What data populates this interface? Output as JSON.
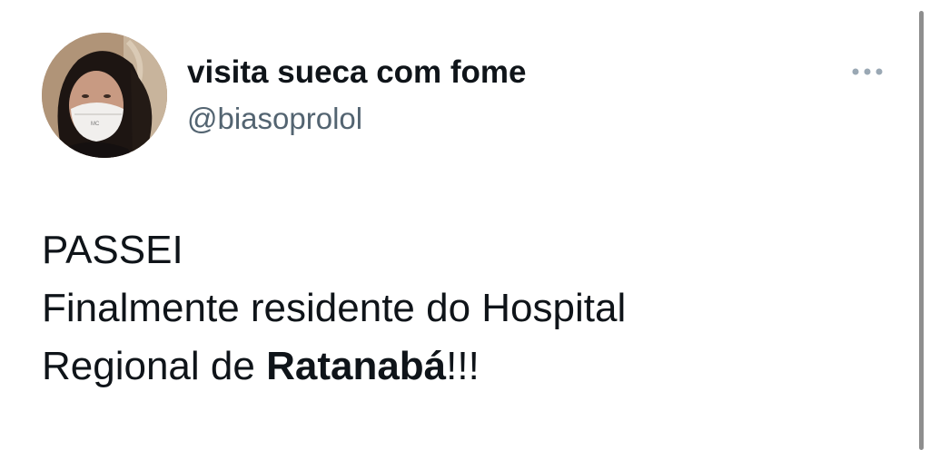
{
  "tweet": {
    "display_name": "visita sueca com fome",
    "handle": "@biasoprolol",
    "lines": [
      {
        "text": "PASSEI"
      },
      {
        "text": "Finalmente residente do Hospital"
      },
      {
        "prefix": "Regional de ",
        "bold": "Ratanabá",
        "suffix": "!!!"
      }
    ]
  },
  "icons": {
    "more": "more-horizontal-icon",
    "avatar": "profile-photo"
  },
  "colors": {
    "text_primary": "#0f1419",
    "text_secondary": "#536471",
    "more_icon": "#8899a6",
    "background": "#ffffff"
  }
}
